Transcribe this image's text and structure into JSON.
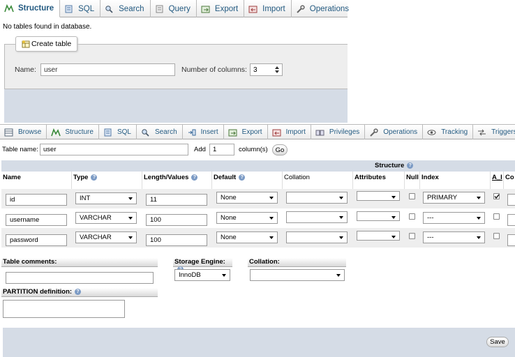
{
  "top_tabs": [
    {
      "label": "Structure",
      "icon": "structure-icon",
      "active": true
    },
    {
      "label": "SQL",
      "icon": "sql-icon"
    },
    {
      "label": "Search",
      "icon": "search-icon"
    },
    {
      "label": "Query",
      "icon": "query-icon"
    },
    {
      "label": "Export",
      "icon": "export-icon"
    },
    {
      "label": "Import",
      "icon": "import-icon"
    },
    {
      "label": "Operations",
      "icon": "wrench-icon"
    }
  ],
  "no_tables_msg": "No tables found in database.",
  "create_table": {
    "legend": "Create table",
    "name_label": "Name:",
    "name_value": "user",
    "columns_label": "Number of columns:",
    "columns_value": "3"
  },
  "tabs2": [
    {
      "label": "Browse",
      "icon": "browse-icon"
    },
    {
      "label": "Structure",
      "icon": "structure-icon"
    },
    {
      "label": "SQL",
      "icon": "sql-icon"
    },
    {
      "label": "Search",
      "icon": "search-icon"
    },
    {
      "label": "Insert",
      "icon": "insert-icon"
    },
    {
      "label": "Export",
      "icon": "export-icon"
    },
    {
      "label": "Import",
      "icon": "import-icon"
    },
    {
      "label": "Privileges",
      "icon": "privileges-icon"
    },
    {
      "label": "Operations",
      "icon": "wrench-icon"
    },
    {
      "label": "Tracking",
      "icon": "eye-icon"
    },
    {
      "label": "Triggers",
      "icon": "triggers-icon"
    }
  ],
  "table_form": {
    "table_name_label": "Table name:",
    "table_name_value": "user",
    "add_label": "Add",
    "add_value": "1",
    "columns_suffix": "column(s)",
    "go_label": "Go"
  },
  "structure_label": "Structure",
  "headers": {
    "name": "Name",
    "type": "Type",
    "length": "Length/Values",
    "default": "Default",
    "collation": "Collation",
    "attributes": "Attributes",
    "null": "Null",
    "index": "Index",
    "ai": "A_I",
    "comments": "Co"
  },
  "rows": [
    {
      "name": "id",
      "type": "INT",
      "length": "11",
      "default": "None",
      "index": "PRIMARY",
      "ai": true
    },
    {
      "name": "username",
      "type": "VARCHAR",
      "length": "100",
      "default": "None",
      "index": "---",
      "ai": false
    },
    {
      "name": "password",
      "type": "VARCHAR",
      "length": "100",
      "default": "None",
      "index": "---",
      "ai": false
    }
  ],
  "options": {
    "table_comments_label": "Table comments:",
    "storage_engine_label": "Storage Engine:",
    "storage_engine_value": "InnoDB",
    "collation_label": "Collation:",
    "partition_label": "PARTITION definition:"
  },
  "save_label": "Save"
}
